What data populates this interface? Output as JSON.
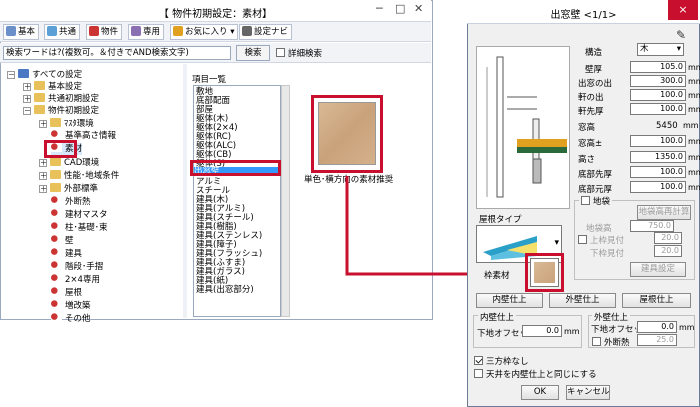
{
  "main_window": {
    "title": "【 物件初期設定：素材】",
    "toolbar": {
      "basic": "基本",
      "common": "共通",
      "property": "物件",
      "dedicated": "専用",
      "favorites": "お気に入り",
      "settings_navi": "設定ナビ"
    },
    "search": {
      "placeholder": "検索ワードは?(複数可。＆付きでAND検索文字)",
      "button": "検索",
      "detail_label": "詳細検索"
    },
    "tree": [
      {
        "label": "すべての設定"
      },
      {
        "label": "基本設定"
      },
      {
        "label": "共通初期設定"
      },
      {
        "label": "物件初期設定"
      },
      {
        "label": "ﾏｽﾀ環境"
      },
      {
        "label": "基準高さ情報"
      },
      {
        "label": "素材"
      },
      {
        "label": "CAD環境"
      },
      {
        "label": "性能･地域条件"
      },
      {
        "label": "外部標準"
      },
      {
        "label": "外断熱"
      },
      {
        "label": "建材マスタ"
      },
      {
        "label": "柱･基礎･束"
      },
      {
        "label": "壁"
      },
      {
        "label": "建具"
      },
      {
        "label": "階段･手摺"
      },
      {
        "label": "2×4専用"
      },
      {
        "label": "屋根"
      },
      {
        "label": "増改築"
      },
      {
        "label": "その他"
      }
    ],
    "item_list": {
      "header": "項目一覧",
      "items": [
        "敷地",
        "底部配面",
        "部屋",
        "躯体(木)",
        "躯体(2×4)",
        "躯体(RC)",
        "躯体(ALC)",
        "躯体(CB)",
        "躯体(S)",
        "出窓壁",
        "アルミ",
        "スチール",
        "建具(木)",
        "建具(アルミ)",
        "建具(スチール)",
        "建具(樹脂)",
        "建具(ステンレス)",
        "建具(障子)",
        "建具(フラッシュ)",
        "建具(ふすま)",
        "建具(ガラス)",
        "建具(紙)",
        "建具(出窓部分)"
      ],
      "selected": "出窓壁"
    },
    "preview_caption": "単色･横方向の素材推奨"
  },
  "dialog": {
    "title": "出窓壁 <1/1>",
    "close": "×",
    "fields": {
      "structure": {
        "label": "構造",
        "value": "木"
      },
      "wall_thickness": {
        "label": "壁厚",
        "value": "105.0",
        "unit": "mm"
      },
      "bay_projection": {
        "label": "出窓の出",
        "value": "300.0",
        "unit": "mm"
      },
      "eave_projection": {
        "label": "軒の出",
        "value": "100.0",
        "unit": "mm"
      },
      "eave_thickness": {
        "label": "軒先厚",
        "value": "100.0",
        "unit": "mm"
      },
      "window_height": {
        "label": "窓高",
        "value": "5450",
        "unit": "mm"
      },
      "window_height_pm": {
        "label": "窓高±",
        "value": "100.0",
        "unit": "mm"
      },
      "height": {
        "label": "高さ",
        "value": "1350.0",
        "unit": "mm"
      },
      "bottom_tip": {
        "label": "底部先厚",
        "value": "100.0",
        "unit": "mm"
      },
      "bottom_base": {
        "label": "底部元厚",
        "value": "100.0",
        "unit": "mm"
      }
    },
    "fukuro": {
      "label": "地袋",
      "recalc_button": "地袋高再計算",
      "fukuro_height": {
        "label": "地袋高",
        "value": "750.0"
      },
      "top_edge": {
        "label": "上枠見付",
        "value": "20.0"
      },
      "bottom_edge": {
        "label": "下枠見付",
        "value": "20.0"
      },
      "fixture_button": "建具設定"
    },
    "roof_type_label": "屋根タイプ",
    "frame_material_label": "枠素材",
    "finish_buttons": {
      "inner": "内壁仕上",
      "outer": "外壁仕上",
      "roof": "屋根仕上"
    },
    "inner_group": {
      "title": "内壁仕上",
      "offset_label": "下地オフセット",
      "value": "0.0",
      "unit": "mm"
    },
    "outer_group": {
      "title": "外壁仕上",
      "offset_label": "下地オフセット",
      "value": "0.0",
      "unit": "mm",
      "insulation_label": "外断熱",
      "insulation_value": "25.0"
    },
    "options": {
      "no_three_side_frame": "三方枠なし",
      "ceiling_same_as_inner": "天井を内壁仕上と同じにする"
    },
    "ok": "OK",
    "cancel": "キャンセル"
  },
  "colors": {
    "highlight": "#c8102e",
    "selection": "#3399ff"
  }
}
